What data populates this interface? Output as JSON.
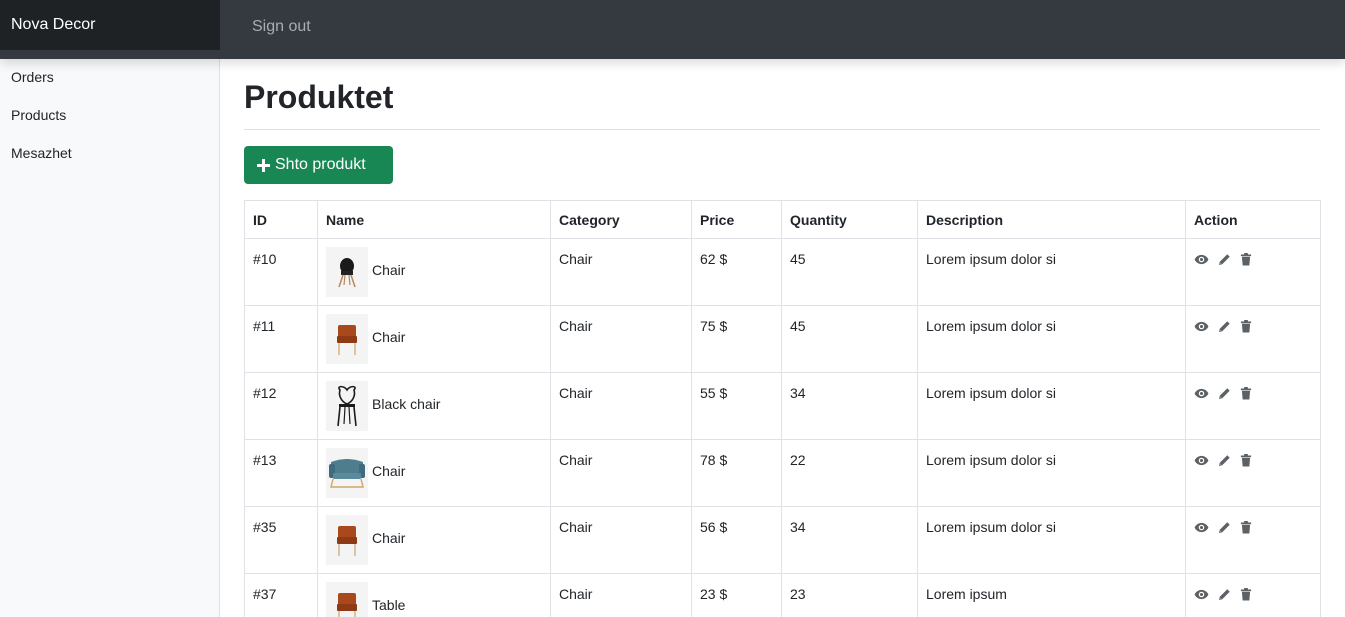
{
  "header": {
    "brand": "Nova Decor",
    "signout": "Sign out"
  },
  "sidebar": {
    "items": [
      {
        "label": "Orders"
      },
      {
        "label": "Products"
      },
      {
        "label": "Mesazhet"
      }
    ]
  },
  "main": {
    "title": "Produktet",
    "add_button": "Shto produkt",
    "columns": [
      "ID",
      "Name",
      "Category",
      "Price",
      "Quantity",
      "Description",
      "Action"
    ],
    "rows": [
      {
        "id": "#10",
        "name": "Chair",
        "category": "Chair",
        "price": "62 $",
        "quantity": "45",
        "description": "Lorem ipsum dolor si",
        "thumb": "black-chair-image"
      },
      {
        "id": "#11",
        "name": "Chair",
        "category": "Chair",
        "price": "75 $",
        "quantity": "45",
        "description": "Lorem ipsum dolor si",
        "thumb": "orange-armchair-image"
      },
      {
        "id": "#12",
        "name": "Black chair",
        "category": "Chair",
        "price": "55 $",
        "quantity": "34",
        "description": "Lorem ipsum dolor si",
        "thumb": "black-wire-chair-image"
      },
      {
        "id": "#13",
        "name": "Chair",
        "category": "Chair",
        "price": "78 $",
        "quantity": "22",
        "description": "Lorem ipsum dolor si",
        "thumb": "blue-armchair-image"
      },
      {
        "id": "#35",
        "name": "Chair",
        "category": "Chair",
        "price": "56 $",
        "quantity": "34",
        "description": "Lorem ipsum dolor si",
        "thumb": "orange-armchair-image"
      },
      {
        "id": "#37",
        "name": "Table",
        "category": "Chair",
        "price": "23 $",
        "quantity": "23",
        "description": "Lorem ipsum",
        "thumb": "orange-armchair-image"
      }
    ],
    "action_icons": [
      "eye-icon",
      "pencil-icon",
      "trash-icon"
    ]
  },
  "colors": {
    "topbar": "#343a40",
    "brand_bg": "#1f2225",
    "accent": "#198754",
    "sidebar_bg": "#f8f9fa",
    "icon": "#5c6166"
  }
}
